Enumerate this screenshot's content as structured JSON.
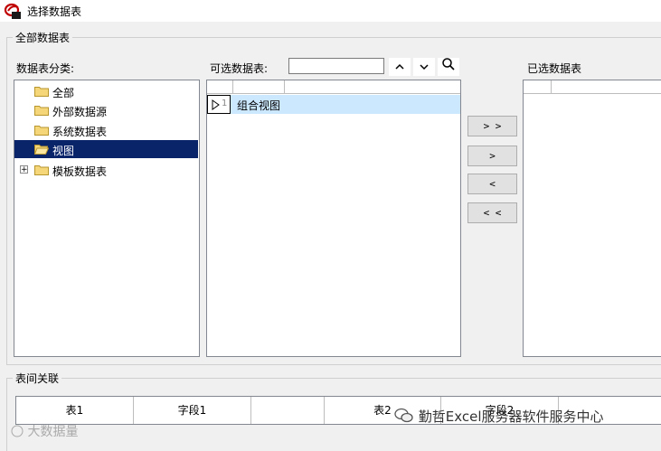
{
  "window": {
    "title": "选择数据表"
  },
  "all_tables_group": {
    "title": "全部数据表"
  },
  "category_panel": {
    "label": "数据表分类:",
    "items": [
      {
        "label": "全部"
      },
      {
        "label": "外部数据源"
      },
      {
        "label": "系统数据表"
      },
      {
        "label": "视图"
      },
      {
        "label": "模板数据表"
      }
    ],
    "selected_index": 3
  },
  "available_panel": {
    "label": "可选数据表:",
    "search_value": "",
    "rows": [
      {
        "num": "1",
        "name": "组合视图"
      }
    ]
  },
  "selected_panel": {
    "label": "已选数据表"
  },
  "transfer_buttons": {
    "add_all": "> >",
    "add": ">",
    "remove": "<",
    "remove_all": "< <"
  },
  "relation_group": {
    "title": "表间关联",
    "columns": [
      "表1",
      "字段1",
      "",
      "表2",
      "字段2",
      ""
    ]
  },
  "watermark": {
    "left": "大数据量",
    "right": "勤哲Excel服务器软件服务中心"
  },
  "colors": {
    "selection": "#0a246a",
    "row_highlight": "#cce8ff"
  }
}
